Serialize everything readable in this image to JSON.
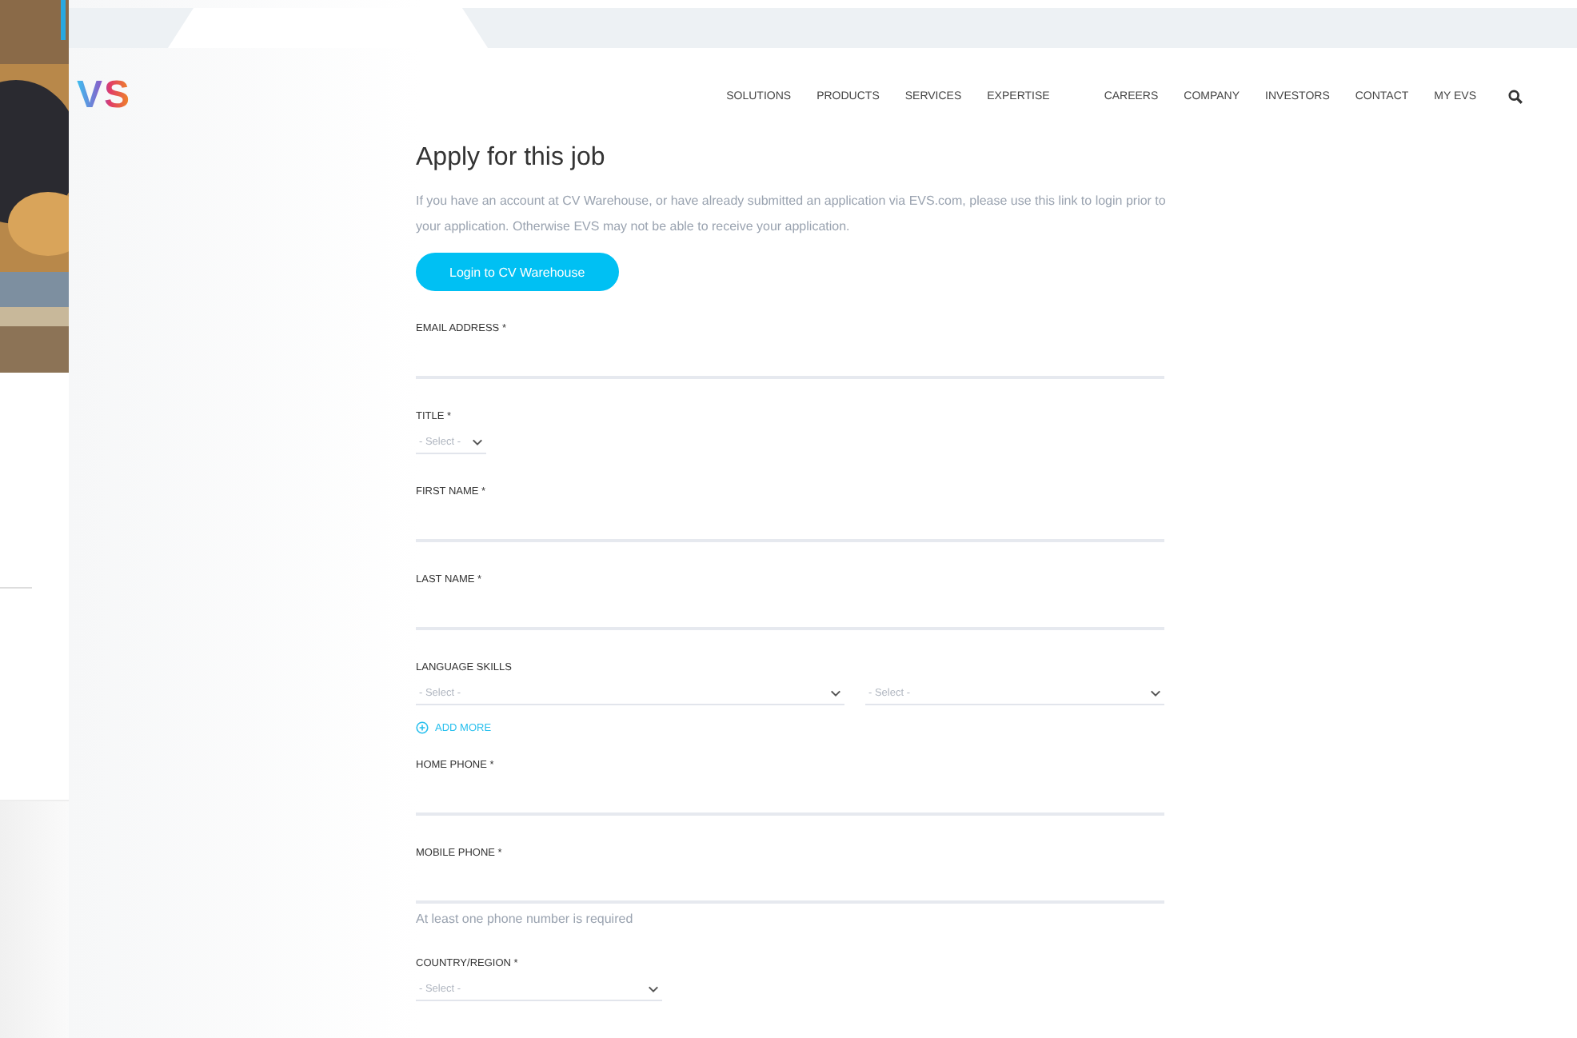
{
  "logo": "VS",
  "nav": [
    "SOLUTIONS",
    "PRODUCTS",
    "SERVICES",
    "EXPERTISE",
    "CAREERS",
    "COMPANY",
    "INVESTORS",
    "CONTACT",
    "MY EVS"
  ],
  "heading": "Apply for this job",
  "intro": "If you have an account at CV Warehouse, or have already submitted an application via EVS.com, please use this link to login prior to your application. Otherwise EVS may not be able to receive your application.",
  "login_button": "Login to CV Warehouse",
  "fields": [
    {
      "kind": "text",
      "label": "EMAIL ADDRESS *"
    },
    {
      "kind": "select-small",
      "label": "TITLE *",
      "placeholder": "- Select -"
    },
    {
      "kind": "text",
      "label": "FIRST NAME *"
    },
    {
      "kind": "text",
      "label": "LAST NAME *"
    },
    {
      "kind": "select-pair",
      "label": "LANGUAGE SKILLS",
      "placeholders": [
        "- Select -",
        "- Select -"
      ],
      "add_more": "ADD MORE"
    },
    {
      "kind": "text",
      "label": "HOME PHONE *"
    },
    {
      "kind": "text",
      "label": "MOBILE PHONE *",
      "hint": "At least one phone number is required"
    },
    {
      "kind": "select-medium",
      "label": "COUNTRY/REGION *",
      "placeholder": "- Select -"
    }
  ]
}
